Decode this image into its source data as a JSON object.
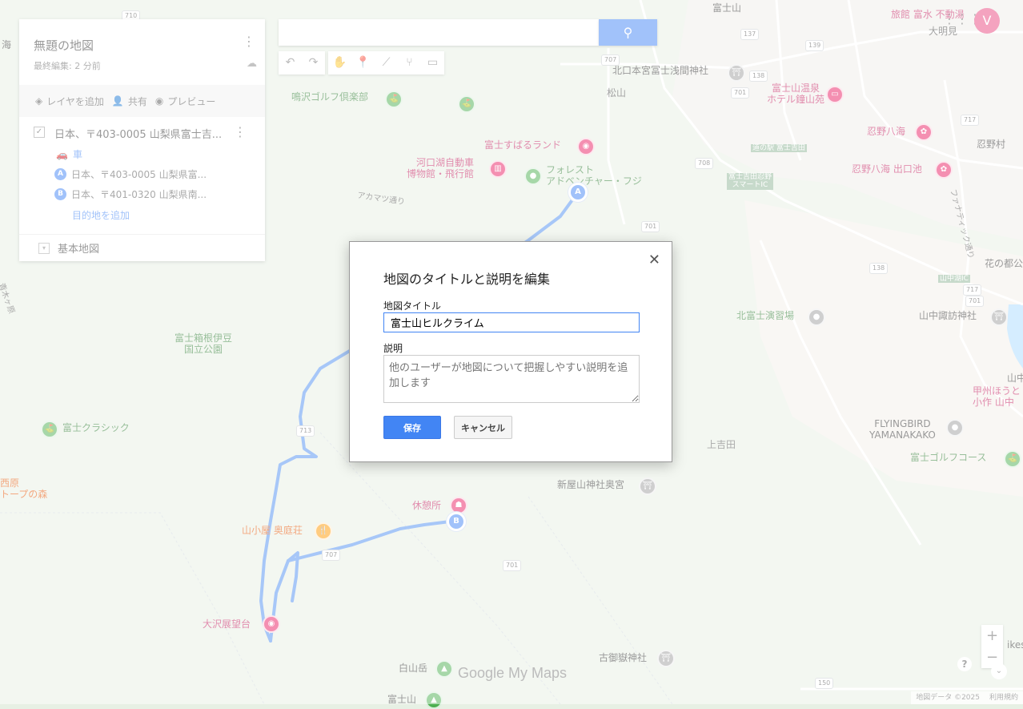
{
  "map": {
    "labels": [
      {
        "id": "fujisan",
        "text": "富士山",
        "color": "#333"
      },
      {
        "id": "kitaguchi",
        "text": "北口本宮冨士浅間神社",
        "color": "#333"
      },
      {
        "id": "matsuyama",
        "text": "松山",
        "color": "#444"
      },
      {
        "id": "onsen",
        "text": "富士山温泉\nホテル鐘山苑",
        "color": "#c2185b"
      },
      {
        "id": "narusawa-golf",
        "text": "鳴沢ゴルフ倶楽部",
        "color": "#2e7d32"
      },
      {
        "id": "subaru",
        "text": "富士すばるランド",
        "color": "#c2185b"
      },
      {
        "id": "kawaguchiko",
        "text": "河口湖自動車\n博物館・飛行館",
        "color": "#c2185b"
      },
      {
        "id": "forest",
        "text": "フォレスト\nアドベンチャー・フジ",
        "color": "#2e7d32"
      },
      {
        "id": "akamatsu",
        "text": "アカマツ通り",
        "color": "#555"
      },
      {
        "id": "oshino",
        "text": "忍野八海",
        "color": "#c2185b"
      },
      {
        "id": "oshino-deguchi",
        "text": "忍野八海 出口池",
        "color": "#c2185b"
      },
      {
        "id": "oshinomura",
        "text": "忍野村",
        "color": "#333"
      },
      {
        "id": "michinoeki",
        "text": "道の駅 富士吉田",
        "color": "#fff"
      },
      {
        "id": "smartic",
        "text": "富士吉田忍野\nスマートIC",
        "color": "#fff"
      },
      {
        "id": "fanatic",
        "text": "ファナティック通り",
        "color": "#555"
      },
      {
        "id": "hananomiyako",
        "text": "花の都公",
        "color": "#333"
      },
      {
        "id": "yamanakako-ic",
        "text": "山中湖IC",
        "color": "#fff"
      },
      {
        "id": "kitafuji",
        "text": "北富士演習場",
        "color": "#2e7d32"
      },
      {
        "id": "yamanaka-suwa",
        "text": "山中諏訪神社",
        "color": "#333"
      },
      {
        "id": "hakone",
        "text": "富士箱根伊豆\n国立公園",
        "color": "#2e7d32"
      },
      {
        "id": "fuji-classic",
        "text": "富士クラシック",
        "color": "#2e7d32"
      },
      {
        "id": "kamiyoshida",
        "text": "上吉田",
        "color": "#555"
      },
      {
        "id": "flyingbird",
        "text": "FLYINGBIRD\nYAMANAKAKO",
        "color": "#333"
      },
      {
        "id": "fuji-golf",
        "text": "富士ゴルフコース",
        "color": "#2e7d32"
      },
      {
        "id": "koshu",
        "text": "甲州ほうと\n小作 山中",
        "color": "#c2185b"
      },
      {
        "id": "shinyasan",
        "text": "新屋山神社奥宮",
        "color": "#333"
      },
      {
        "id": "kyukeijo",
        "text": "休憩所",
        "color": "#c2185b"
      },
      {
        "id": "okuniwa",
        "text": "山小屋 奥庭荘",
        "color": "#e65100"
      },
      {
        "id": "osawa",
        "text": "大沢展望台",
        "color": "#c2185b"
      },
      {
        "id": "shirayama",
        "text": "白山岳",
        "color": "#333"
      },
      {
        "id": "komitake",
        "text": "古御嶽神社",
        "color": "#333"
      },
      {
        "id": "fujisan-bottom",
        "text": "富士山",
        "color": "#333"
      },
      {
        "id": "ryokan",
        "text": "旅館 富水 不動湯",
        "color": "#c2185b"
      },
      {
        "id": "daimyomi",
        "text": "大明見",
        "color": "#444"
      },
      {
        "id": "nishihara",
        "text": "西原\nトープの森",
        "color": "#e65100"
      },
      {
        "id": "aokigahara",
        "text": "青木ヶ原",
        "color": "#555"
      },
      {
        "id": "umi",
        "text": "海",
        "color": "#333"
      },
      {
        "id": "yamanaka-kr",
        "text": "山中",
        "color": "#333"
      },
      {
        "id": "bikes",
        "text": "ikes",
        "color": "#333"
      }
    ],
    "route_shields": [
      "710",
      "139",
      "137",
      "707",
      "701",
      "138",
      "717",
      "701",
      "708",
      "701",
      "138",
      "717",
      "713",
      "707",
      "701",
      "150"
    ],
    "markers": {
      "a": "A",
      "b": "B"
    }
  },
  "panel": {
    "title": "無題の地図",
    "subtitle": "最終編集: 2 分前",
    "actions": {
      "add_layer": "レイヤを追加",
      "share": "共有",
      "preview": "プレビュー"
    },
    "layer_name": "日本、〒403-0005 山梨県富士吉...",
    "mode": "車",
    "waypoint_a": {
      "badge": "A",
      "text": "日本、〒403-0005 山梨県富..."
    },
    "waypoint_b": {
      "badge": "B",
      "text": "日本、〒401-0320 山梨県南..."
    },
    "add_destination": "目的地を追加",
    "basemap": "基本地図"
  },
  "search": {
    "placeholder": "",
    "value": ""
  },
  "account": {
    "initial": "V"
  },
  "logo": "Google My Maps",
  "copyright": {
    "data": "地図データ ©2025",
    "terms": "利用規約"
  },
  "dialog": {
    "title": "地図のタイトルと説明を編集",
    "title_label": "地図タイトル",
    "title_value": "富士山ヒルクライム",
    "desc_label": "説明",
    "desc_placeholder": "他のユーザーが地図について把握しやすい説明を追加します",
    "save": "保存",
    "cancel": "キャンセル"
  },
  "colors": {
    "accent": "#4285f4",
    "map_bg": "#e7f0e4",
    "road": "#ffffff",
    "water": "#aadaff",
    "route": "#4285f4"
  }
}
